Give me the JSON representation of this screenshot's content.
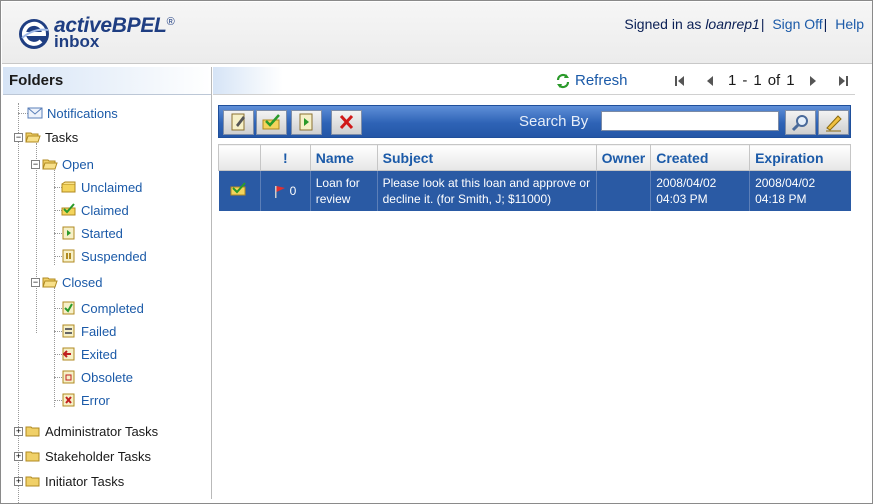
{
  "header": {
    "logo_line1": "activeBPEL",
    "logo_reg": "®",
    "logo_line2": "inbox",
    "signed_in_prefix": "Signed in as ",
    "username": "loanrep1",
    "sign_off": "Sign Off",
    "help": "Help",
    "separator": "|"
  },
  "folders": {
    "title": "Folders",
    "notifications": "Notifications",
    "tasks": "Tasks",
    "open": "Open",
    "unclaimed": "Unclaimed",
    "claimed": "Claimed",
    "started": "Started",
    "suspended": "Suspended",
    "closed": "Closed",
    "completed": "Completed",
    "failed": "Failed",
    "exited": "Exited",
    "obsolete": "Obsolete",
    "error": "Error",
    "administrator_tasks": "Administrator Tasks",
    "stakeholder_tasks": "Stakeholder Tasks",
    "initiator_tasks": "Initiator Tasks"
  },
  "topbar": {
    "refresh": "Refresh",
    "page_start": "1",
    "page_dash": "-",
    "page_end": "1",
    "page_of": "of",
    "page_total": "1"
  },
  "toolbar": {
    "search_label": "Search By",
    "search_value": ""
  },
  "table": {
    "headers": [
      "",
      "!",
      "Name",
      "Subject",
      "Owner",
      "Created",
      "Expiration"
    ],
    "rows": [
      {
        "priority": "0",
        "name": "Loan for review",
        "subject": "Please look at this loan and approve or decline it. (for Smith, J; $11000)",
        "owner": "",
        "created": "2008/04/02 04:03 PM",
        "expiration": "2008/04/02 04:18 PM"
      }
    ]
  },
  "colors": {
    "brand": "#1f3e82",
    "link": "#1b5aa8",
    "toolbar": "#2e63b6",
    "selected_row": "#2a5aa4"
  }
}
